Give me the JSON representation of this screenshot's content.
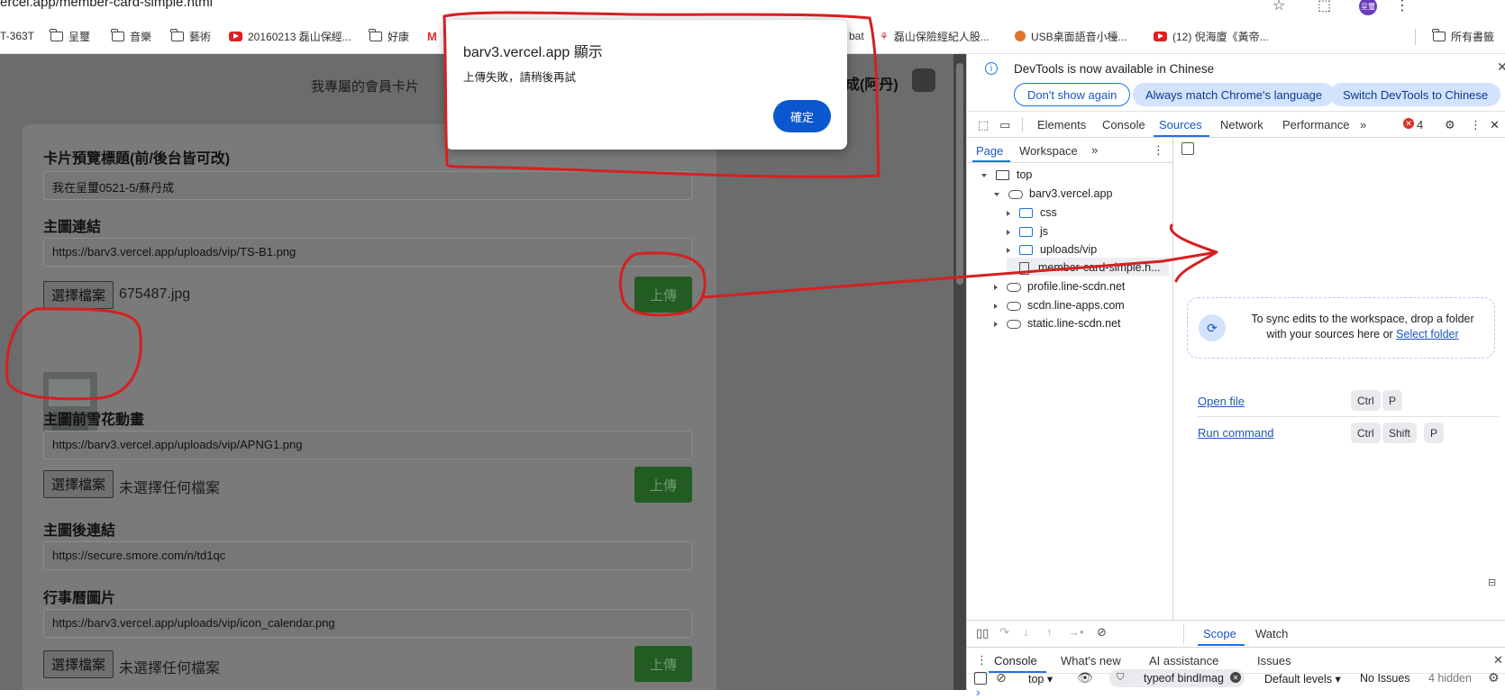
{
  "browser": {
    "url": "ercel.app/member-card-simple.html",
    "avatar_text": "呈璽"
  },
  "bookmarks": [
    {
      "label": "T-363T",
      "icon": "none"
    },
    {
      "label": "呈璽",
      "icon": "folder-icon"
    },
    {
      "label": "音樂",
      "icon": "folder-icon"
    },
    {
      "label": "藝術",
      "icon": "folder-icon"
    },
    {
      "label": "20160213 磊山保經...",
      "icon": "youtube-icon"
    },
    {
      "label": "好康",
      "icon": "folder-icon"
    },
    {
      "label": "bat",
      "icon": "none"
    },
    {
      "label": "磊山保險經紀人股...",
      "icon": "site-icon"
    },
    {
      "label": "USB桌面語音小檯...",
      "icon": "site-icon"
    },
    {
      "label": "(12) 倪海廈《黃帝...",
      "icon": "youtube-icon"
    },
    {
      "label": "所有書籤",
      "icon": "folder-icon"
    }
  ],
  "page": {
    "header_title": "我專屬的會員卡片",
    "user_name": "成(阿丹)",
    "fields": {
      "preview_title_label": "卡片預覽標題(前/後台皆可改)",
      "preview_title_value": "我在呈璽0521-5/蘇丹成",
      "main_image_label": "主圖連結",
      "main_image_value": "https://barv3.vercel.app/uploads/vip/TS-B1.png",
      "main_image_file": "675487.jpg",
      "snow_label": "主圖前雪花動畫",
      "snow_value": "https://barv3.vercel.app/uploads/vip/APNG1.png",
      "snow_file": "未選擇任何檔案",
      "back_link_label": "主圖後連結",
      "back_link_value": "https://secure.smore.com/n/td1qc",
      "calendar_label": "行事曆圖片",
      "calendar_value": "https://barv3.vercel.app/uploads/vip/icon_calendar.png",
      "calendar_file": "未選擇任何檔案"
    },
    "choose_file_label": "選擇檔案",
    "upload_label": "上傳"
  },
  "alert": {
    "title": "barv3.vercel.app 顯示",
    "message": "上傳失敗，請稍後再試",
    "ok_label": "確定"
  },
  "devtools": {
    "banner": {
      "text": "DevTools is now available in Chinese",
      "btn_dont_show": "Don't show again",
      "btn_match": "Always match Chrome's language",
      "btn_switch": "Switch DevTools to Chinese"
    },
    "tabs": [
      "Elements",
      "Console",
      "Sources",
      "Network",
      "Performance"
    ],
    "active_tab": "Sources",
    "error_count": "4",
    "subtabs": [
      "Page",
      "Workspace"
    ],
    "tree": {
      "top": "top",
      "domain": "barv3.vercel.app",
      "folders": [
        "css",
        "js",
        "uploads/vip"
      ],
      "file": "member-card-simple.h...",
      "other_domains": [
        "profile.line-scdn.net",
        "scdn.line-apps.com",
        "static.line-scdn.net"
      ]
    },
    "workspace_hint": "To sync edits to the workspace, drop a folder with your sources here or",
    "select_folder": "Select folder",
    "open_file": "Open file",
    "run_command": "Run command",
    "keys_open": [
      "Ctrl",
      "P"
    ],
    "keys_run": [
      "Ctrl",
      "Shift",
      "P"
    ],
    "debug_tabs": [
      "Scope",
      "Watch"
    ],
    "drawer_tabs": [
      "Console",
      "What's new",
      "AI assistance",
      "Issues"
    ],
    "console": {
      "context": "top",
      "filter": "typeof bindImag",
      "levels": "Default levels",
      "issues": "No Issues",
      "hidden": "4 hidden",
      "prompt": "›"
    }
  }
}
